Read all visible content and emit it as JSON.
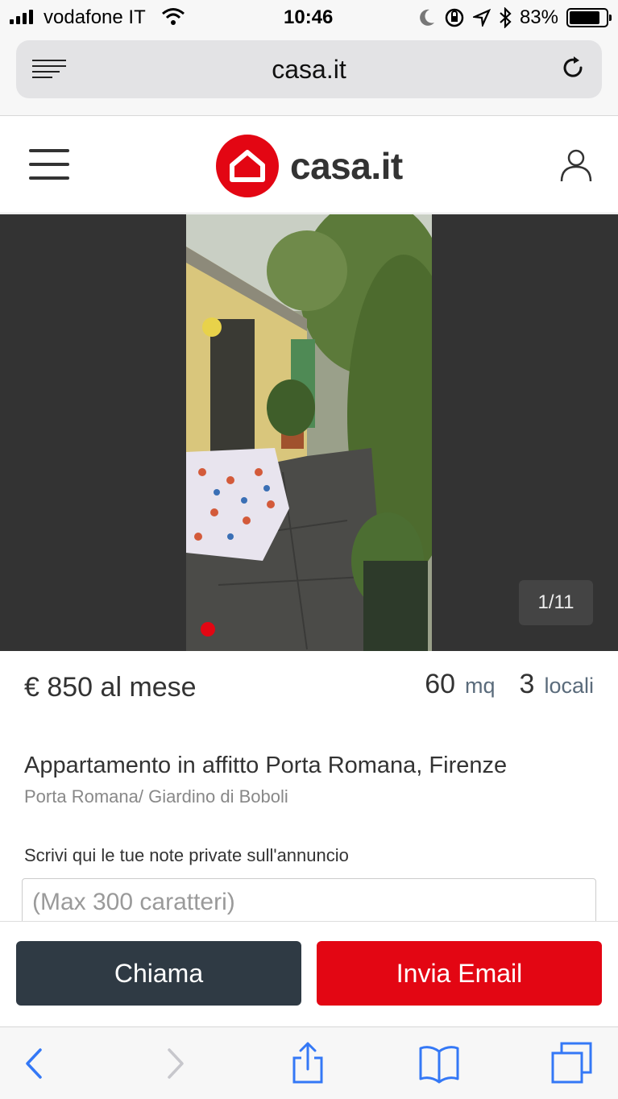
{
  "status_bar": {
    "carrier": "vodafone IT",
    "time": "10:46",
    "battery_percent": "83%",
    "battery_level": 0.83
  },
  "browser": {
    "url": "casa.it"
  },
  "site": {
    "logo_text": "casa.it",
    "brand_color": "#e30613"
  },
  "gallery": {
    "counter": "1/11"
  },
  "listing": {
    "price": "€ 850 al mese",
    "area_value": "60",
    "area_unit": "mq",
    "rooms_value": "3",
    "rooms_unit": "locali",
    "title": "Appartamento in affitto Porta Romana, Firenze",
    "location": "Porta Romana/ Giardino di Boboli"
  },
  "notes": {
    "label": "Scrivi qui le tue note private sull'annuncio",
    "placeholder": "(Max 300 caratteri)"
  },
  "actions": {
    "call_label": "Chiama",
    "email_label": "Invia Email"
  },
  "icons": [
    "signal-icon",
    "wifi-icon",
    "moon-icon",
    "orientation-lock-icon",
    "location-icon",
    "bluetooth-icon",
    "battery-icon",
    "reader-icon",
    "reload-icon",
    "menu-icon",
    "user-icon",
    "back-icon",
    "forward-icon",
    "share-icon",
    "bookmarks-icon",
    "tabs-icon"
  ]
}
